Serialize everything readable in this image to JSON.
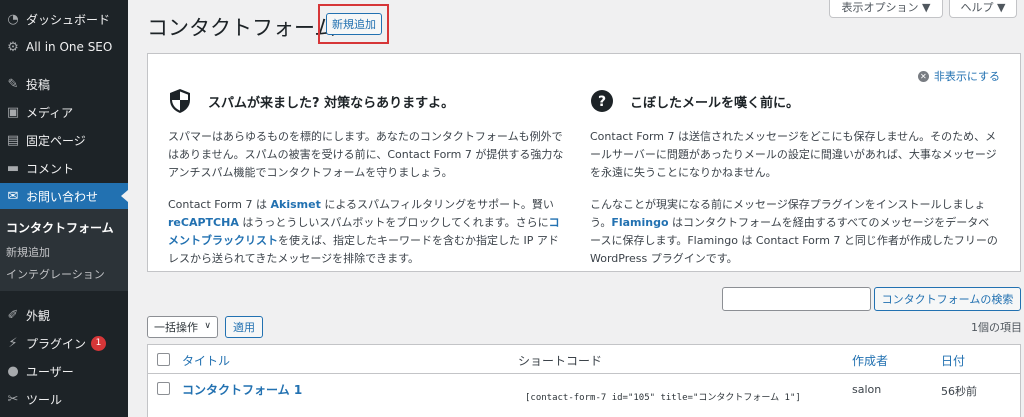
{
  "sidebar": {
    "items": [
      {
        "label": "ダッシュボード",
        "icon": "dashboard-icon"
      },
      {
        "label": "All in One SEO",
        "icon": "gear-icon"
      },
      {
        "label": "投稿",
        "icon": "pin-icon"
      },
      {
        "label": "メディア",
        "icon": "media-icon"
      },
      {
        "label": "固定ページ",
        "icon": "page-icon"
      },
      {
        "label": "コメント",
        "icon": "comment-icon"
      },
      {
        "label": "お問い合わせ",
        "icon": "mail-icon"
      },
      {
        "label": "外観",
        "icon": "brush-icon"
      },
      {
        "label": "プラグイン",
        "icon": "plugin-icon",
        "badge": "1"
      },
      {
        "label": "ユーザー",
        "icon": "user-icon"
      },
      {
        "label": "ツール",
        "icon": "wrench-icon"
      }
    ],
    "submenu": [
      "コンタクトフォーム",
      "新規追加",
      "インテグレーション"
    ]
  },
  "header": {
    "title": "コンタクトフォーム",
    "add_new": "新規追加",
    "screen_options": "表示オプション ▼",
    "help": "ヘルプ ▼"
  },
  "panel": {
    "dismiss": "非表示にする",
    "left": {
      "heading": "スパムが来ました? 対策ならありますよ。",
      "p1": "スパマーはあらゆるものを標的にします。あなたのコンタクトフォームも例外ではありません。スパムの被害を受ける前に、Contact Form 7 が提供する強力なアンチスパム機能でコンタクトフォームを守りましょう。",
      "p2a": "Contact Form 7 は ",
      "p2b": "Akismet",
      "p2c": " によるスパムフィルタリングをサポート。賢い ",
      "p2d": "reCAPTCHA",
      "p2e": " はうっとうしいスパムボットをブロックしてくれます。さらに",
      "p2f": "コメントブラックリスト",
      "p2g": "を使えば、指定したキーワードを含むか指定した IP アドレスから送られてきたメッセージを排除できます。"
    },
    "right": {
      "heading": "こぼしたメールを嘆く前に。",
      "p1": "Contact Form 7 は送信されたメッセージをどこにも保存しません。そのため、メールサーバーに問題があったりメールの設定に間違いがあれば、大事なメッセージを永遠に失うことになりかねません。",
      "p2a": "こんなことが現実になる前にメッセージ保存プラグインをインストールしましょう。",
      "p2b": "Flamingo",
      "p2c": " はコンタクトフォームを経由するすべてのメッセージをデータベースに保存します。Flamingo は Contact Form 7 と同じ作者が作成したフリーの WordPress プラグインです。"
    }
  },
  "search": {
    "button": "コンタクトフォームの検索",
    "value": ""
  },
  "bulk": {
    "select": "一括操作",
    "apply": "適用"
  },
  "count": "1個の項目",
  "table": {
    "headers": {
      "title": "タイトル",
      "shortcode": "ショートコード",
      "author": "作成者",
      "date": "日付"
    },
    "rows": [
      {
        "title": "コンタクトフォーム 1",
        "shortcode": "[contact-form-7 id=\"105\" title=\"コンタクトフォーム 1\"]",
        "author": "salon",
        "date": "56秒前"
      }
    ]
  },
  "colors": {
    "accent": "#2271b1",
    "sidebar": "#1d2327",
    "highlight": "#d63638"
  }
}
